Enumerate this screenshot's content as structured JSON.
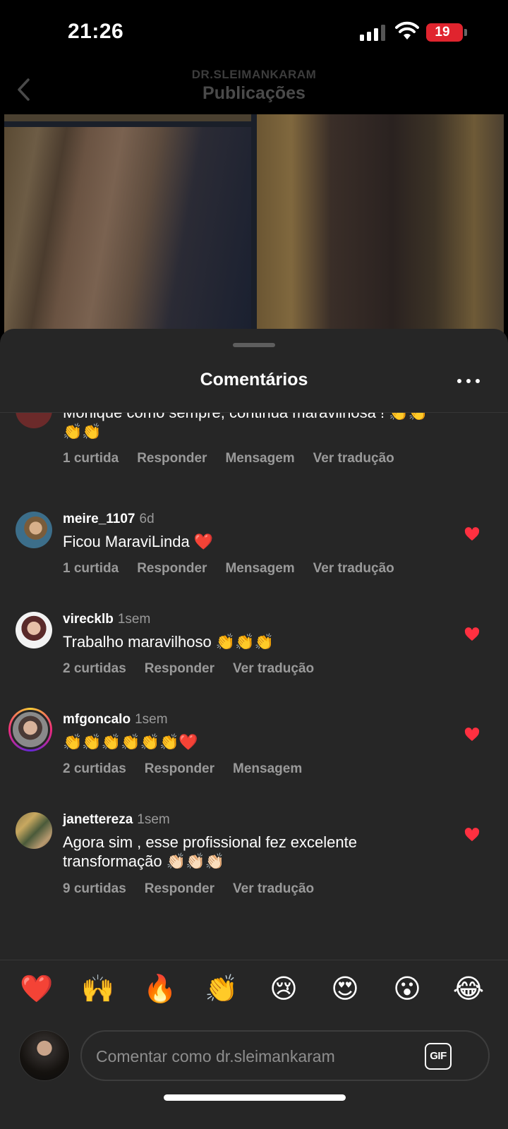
{
  "status_bar": {
    "time": "21:26",
    "battery": "19"
  },
  "header": {
    "account": "DR.SLEIMANKARAM",
    "title": "Publicações"
  },
  "sheet": {
    "title": "Comentários"
  },
  "comments": [
    {
      "username": "",
      "time": "",
      "text": "Monique como sempre, continua maravilhosa ! 👏👏👏👏",
      "likes": "1 curtida",
      "reply": "Responder",
      "message": "Mensagem",
      "translate": "Ver tradução",
      "liked": true
    },
    {
      "username": "meire_1107",
      "time": "6d",
      "text": "Ficou MaraviLinda ❤️",
      "likes": "1 curtida",
      "reply": "Responder",
      "message": "Mensagem",
      "translate": "Ver tradução",
      "liked": true
    },
    {
      "username": "virecklb",
      "time": "1sem",
      "text": "Trabalho  maravilhoso 👏👏👏",
      "likes": "2 curtidas",
      "reply": "Responder",
      "translate": "Ver tradução",
      "liked": true
    },
    {
      "username": "mfgoncalo",
      "time": "1sem",
      "text": "👏👏👏👏👏👏❤️",
      "likes": "2 curtidas",
      "reply": "Responder",
      "message": "Mensagem",
      "liked": true
    },
    {
      "username": "janettereza",
      "time": "1sem",
      "text": "Agora sim , esse profissional fez excelente transformação 👏🏻👏🏻👏🏻",
      "likes": "9 curtidas",
      "reply": "Responder",
      "translate": "Ver tradução",
      "liked": true
    }
  ],
  "reactions": [
    "❤️",
    "🙌",
    "🔥",
    "👏",
    "😢",
    "😍",
    "😮",
    "😂"
  ],
  "composer": {
    "placeholder": "Comentar como dr.sleimankaram",
    "gif_label": "GIF"
  },
  "colors": {
    "sheet_bg": "#262626",
    "like_red": "#ff3040",
    "muted_text": "#9a9a9a"
  }
}
